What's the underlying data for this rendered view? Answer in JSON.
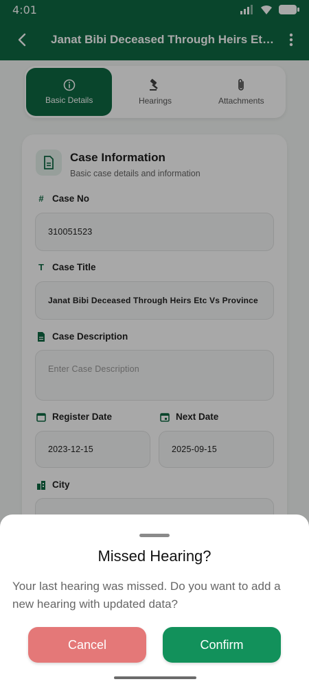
{
  "status_bar": {
    "time": "4:01"
  },
  "app_bar": {
    "title": "Janat Bibi Deceased Through Heirs Etc Vs Province"
  },
  "tabs": [
    {
      "label": "Basic Details",
      "icon": "info-icon",
      "active": true
    },
    {
      "label": "Hearings",
      "icon": "gavel-icon",
      "active": false
    },
    {
      "label": "Attachments",
      "icon": "paperclip-icon",
      "active": false
    }
  ],
  "card": {
    "title": "Case Information",
    "subtitle": "Basic case details and information",
    "fields": {
      "case_no": {
        "label": "Case No",
        "value": "310051523"
      },
      "case_title": {
        "label": "Case Title",
        "value": "Janat Bibi Deceased Through Heirs Etc Vs Province"
      },
      "case_description": {
        "label": "Case Description",
        "placeholder": "Enter Case Description"
      },
      "register_date": {
        "label": "Register Date",
        "value": "2023-12-15"
      },
      "next_date": {
        "label": "Next Date",
        "value": "2025-09-15"
      },
      "city": {
        "label": "City"
      }
    }
  },
  "dialog": {
    "title": "Missed Hearing?",
    "message": "Your last hearing was missed. Do you want to add a new hearing with updated data?",
    "cancel_label": "Cancel",
    "confirm_label": "Confirm"
  },
  "colors": {
    "primary": "#0f6a43",
    "cancel": "#e47878",
    "confirm": "#12915b"
  }
}
